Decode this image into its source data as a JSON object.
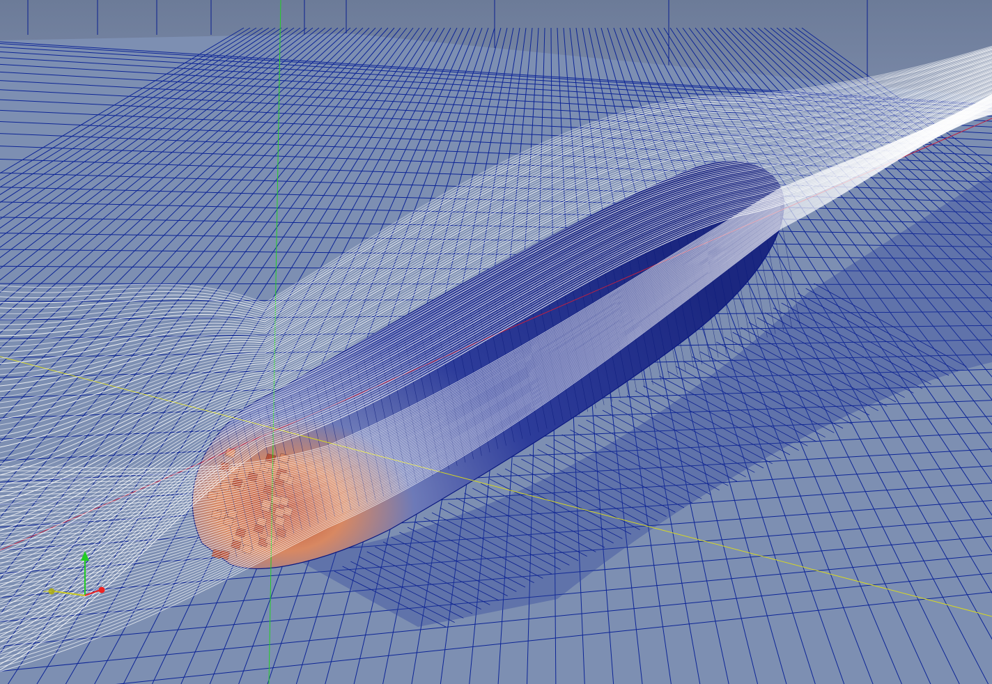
{
  "viewport": {
    "render_view": "3D",
    "background_color": "#6e7f9f",
    "colors": {
      "ground_fill": "#7b8db0",
      "mesh_edges": "#0a1f8f",
      "streamlines": "#ffffff",
      "body_low": "#1b2a8c",
      "body_high": "#c96a47",
      "x_axis": "#ff3030",
      "y_axis": "#30e030",
      "z_axis": "#e0e020",
      "center_axis_line_red": "#c02040",
      "center_axis_line_yellow": "#d8d820",
      "center_axis_line_green": "#20d030"
    }
  },
  "orientation_axes": {
    "axes": [
      "X",
      "Y",
      "Z"
    ],
    "icon": "orientation-axes-icon"
  }
}
